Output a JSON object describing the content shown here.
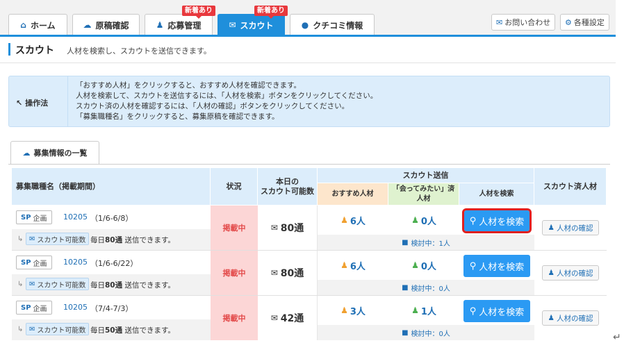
{
  "nav": {
    "tabs": [
      {
        "label": "ホーム",
        "icon": "home-icon"
      },
      {
        "label": "原稿確認",
        "icon": "cloud-icon"
      },
      {
        "label": "応募管理",
        "icon": "users-icon",
        "badge": "新着あり"
      },
      {
        "label": "スカウト",
        "icon": "mail-icon",
        "badge": "新着あり",
        "active": true
      },
      {
        "label": "クチコミ情報",
        "icon": "chat-icon"
      }
    ],
    "contact_label": "お問い合わせ",
    "settings_label": "各種設定"
  },
  "page": {
    "title": "スカウト",
    "description": "人材を検索し、スカウトを送信できます。"
  },
  "howto": {
    "label": "操作法",
    "lines": [
      "「おすすめ人材」をクリックすると、おすすめ人材を確認できます。",
      "人材を検索して、スカウトを送信するには、「人材を検索」ボタンをクリックしてください。",
      "スカウト済の人材を確認するには、「人材の確認」ボタンをクリックしてください。",
      "「募集職種名」をクリックすると、募集原稿を確認できます。"
    ]
  },
  "section_tab": "募集情報の一覧",
  "table": {
    "headers": {
      "job": "募集職種名（掲載期間）",
      "status": "状況",
      "available": "本日の\nスカウト可能数",
      "scout_send": "スカウト送信",
      "recommended": "おすすめ人材",
      "meet": "「会ってみたい」済\n人材",
      "search": "人材を検索",
      "scouted": "スカウト済人材"
    },
    "rows": [
      {
        "sp": "SP",
        "plan": "企画",
        "id": "10205",
        "period": "（1/6-6/8）",
        "chip": "スカウト可能数",
        "daily_prefix": "毎日",
        "daily_count": "80通",
        "daily_suffix": "送信できます。",
        "status": "掲載中",
        "available": "80通",
        "recommended": "6人",
        "meet": "0人",
        "search_label": "人材を検索",
        "review": "検討中：1人",
        "confirm_label": "人材の確認"
      },
      {
        "sp": "SP",
        "plan": "企画",
        "id": "10205",
        "period": "（1/6-6/22）",
        "chip": "スカウト可能数",
        "daily_prefix": "毎日",
        "daily_count": "80通",
        "daily_suffix": "送信できます。",
        "status": "掲載中",
        "available": "80通",
        "recommended": "6人",
        "meet": "0人",
        "search_label": "人材を検索",
        "review": "検討中：0人",
        "confirm_label": "人材の確認"
      },
      {
        "sp": "SP",
        "plan": "企画",
        "id": "10205",
        "period": "（7/4-7/3）",
        "chip": "スカウト可能数",
        "daily_prefix": "毎日",
        "daily_count": "50通",
        "daily_suffix": "送信できます。",
        "status": "掲載中",
        "available": "42通",
        "recommended": "3人",
        "meet": "1人",
        "search_label": "人材を検索",
        "review": "検討中：0人",
        "confirm_label": "人材の確認"
      }
    ]
  },
  "colors": {
    "accent": "#1f8fdb",
    "highlight": "#e0201f",
    "status_bg": "#fcd6d6"
  }
}
